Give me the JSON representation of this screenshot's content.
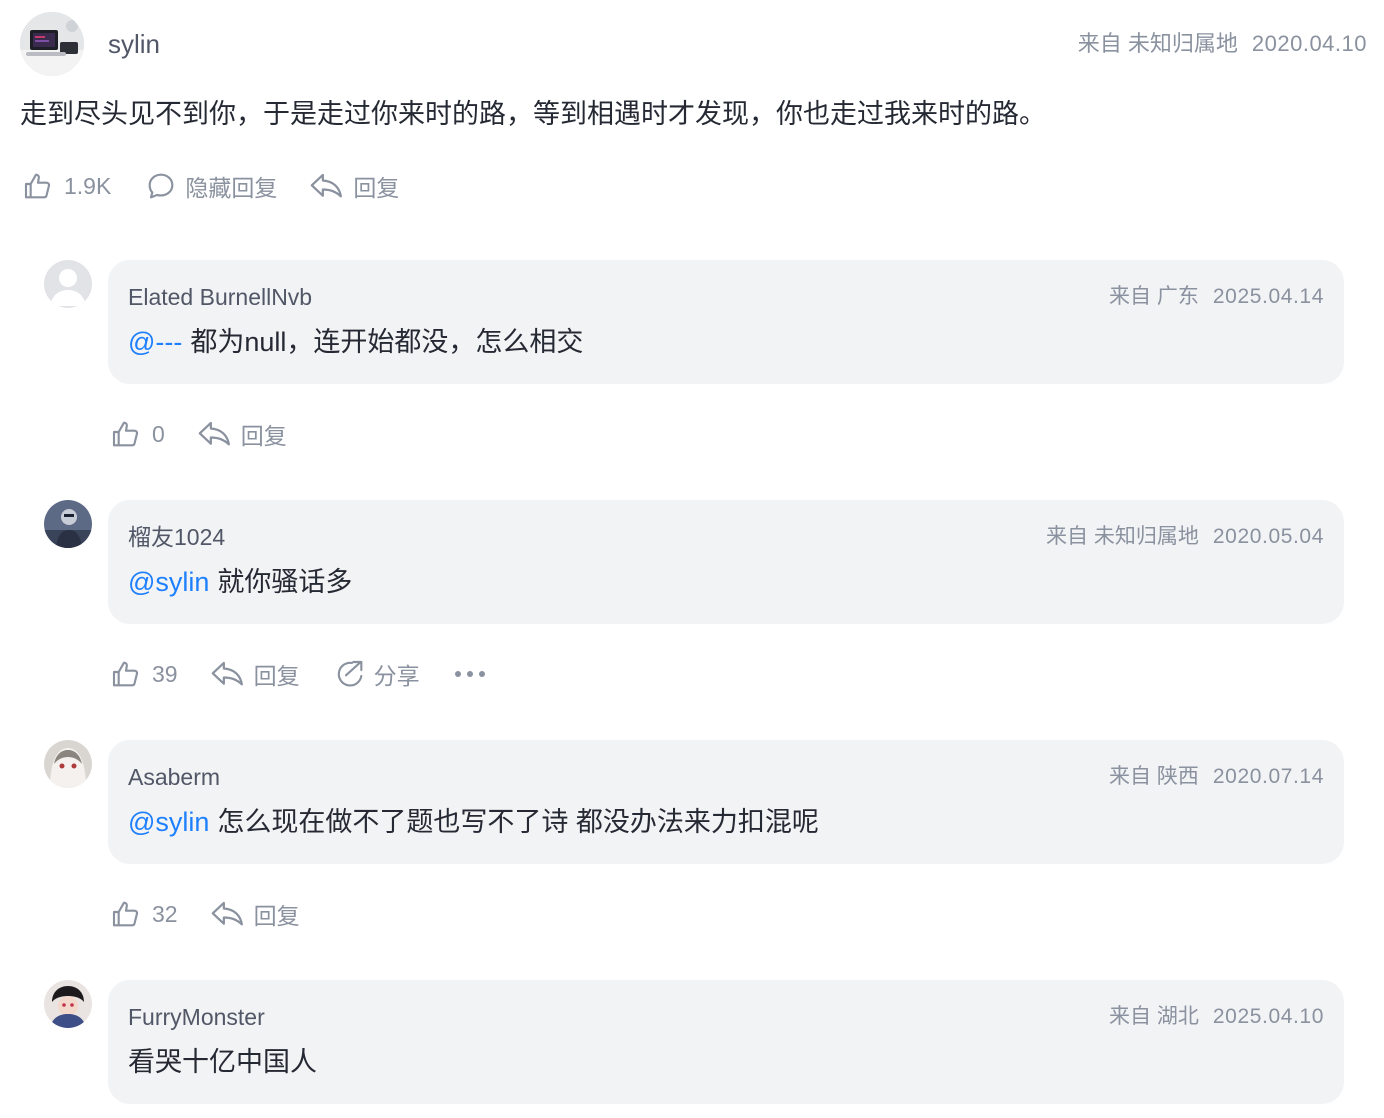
{
  "colors": {
    "link": "#1e80ff",
    "muted": "#8a919f",
    "bubble": "#f2f3f5",
    "text": "#252933"
  },
  "main_comment": {
    "author": "sylin",
    "location": "来自 未知归属地",
    "date": "2020.04.10",
    "text": "走到尽头见不到你，于是走过你来时的路，等到相遇时才发现，你也走过我来时的路。",
    "likes": "1.9K",
    "hide_replies_label": "隐藏回复",
    "reply_label": "回复"
  },
  "replies": [
    {
      "author": "Elated BurnellNvb",
      "location": "来自 广东",
      "date": "2025.04.14",
      "mention": "@---",
      "text": "都为null，连开始都没，怎么相交",
      "likes": "0",
      "reply_label": "回复"
    },
    {
      "author": "榴友1024",
      "location": "来自 未知归属地",
      "date": "2020.05.04",
      "mention": "@sylin",
      "text": "就你骚话多",
      "likes": "39",
      "reply_label": "回复",
      "share_label": "分享",
      "more_icon": "more-dots-icon"
    },
    {
      "author": "Asaberm",
      "location": "来自 陕西",
      "date": "2020.07.14",
      "mention": "@sylin",
      "text": "怎么现在做不了题也写不了诗 都没办法来力扣混呢",
      "likes": "32",
      "reply_label": "回复"
    },
    {
      "author": "FurryMonster",
      "location": "来自 湖北",
      "date": "2025.04.10",
      "mention": "",
      "text": "看哭十亿中国人"
    }
  ]
}
